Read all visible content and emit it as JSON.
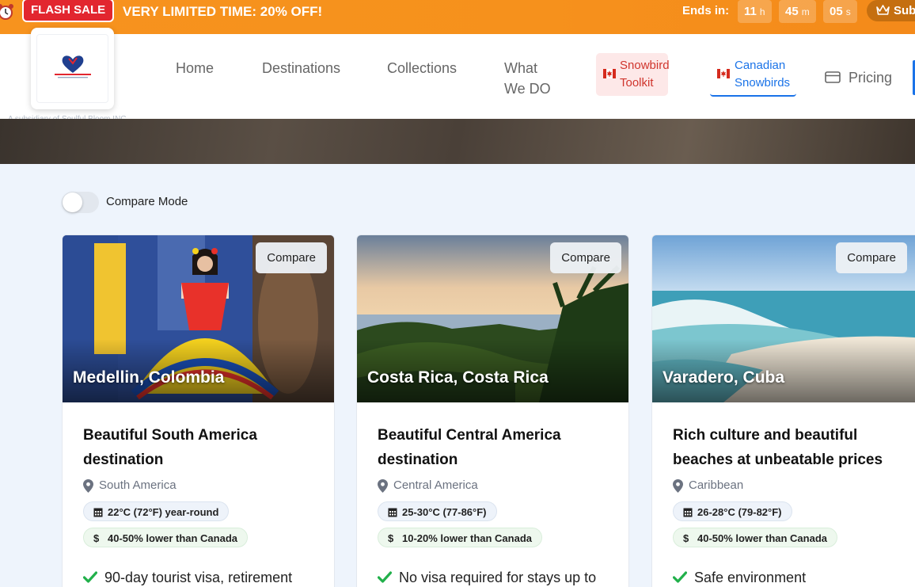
{
  "flash_sale": {
    "badge": "FLASH SALE",
    "text": "VERY LIMITED TIME:  20% OFF!",
    "ends_label": "Ends in:",
    "hours": "11",
    "hours_unit": "h",
    "minutes": "45",
    "minutes_unit": "m",
    "seconds": "05",
    "seconds_unit": "s",
    "subscribe_label": "Sub"
  },
  "header": {
    "logo_subtitle": "A subsidiary of Soulful Bloom INC",
    "nav": {
      "home": "Home",
      "destinations": "Destinations",
      "collections": "Collections",
      "what_we_do_line1": "What",
      "what_we_do_line2": "We DO",
      "toolkit_line1": "Snowbird",
      "toolkit_line2": "Toolkit",
      "canadian_line1": "Canadian",
      "canadian_line2": "Snowbirds",
      "pricing": "Pricing"
    }
  },
  "compare_mode": {
    "label": "Compare Mode",
    "enabled": false
  },
  "compare_button_label": "Compare",
  "destinations": [
    {
      "city": "Medellin, Colombia",
      "title": "Beautiful South America destination",
      "region": "South America",
      "temperature": "22°C (72°F) year-round",
      "cost": "40-50% lower than Canada",
      "feature": "90-day tourist visa, retirement"
    },
    {
      "city": "Costa Rica, Costa Rica",
      "title": "Beautiful Central America destination",
      "region": "Central America",
      "temperature": "25-30°C (77-86°F)",
      "cost": "10-20% lower than Canada",
      "feature": "No visa required for stays up to"
    },
    {
      "city": "Varadero, Cuba",
      "title": "Rich culture and beautiful beaches at unbeatable prices",
      "region": "Caribbean",
      "temperature": "26-28°C (79-82°F)",
      "cost": "40-50% lower than Canada",
      "feature": "Safe environment"
    }
  ],
  "colors": {
    "flash_orange": "#f7931e",
    "flash_red": "#e2262f",
    "primary_blue": "#1a73e8",
    "page_bg": "#eef4fc",
    "check_green": "#22b04b"
  }
}
